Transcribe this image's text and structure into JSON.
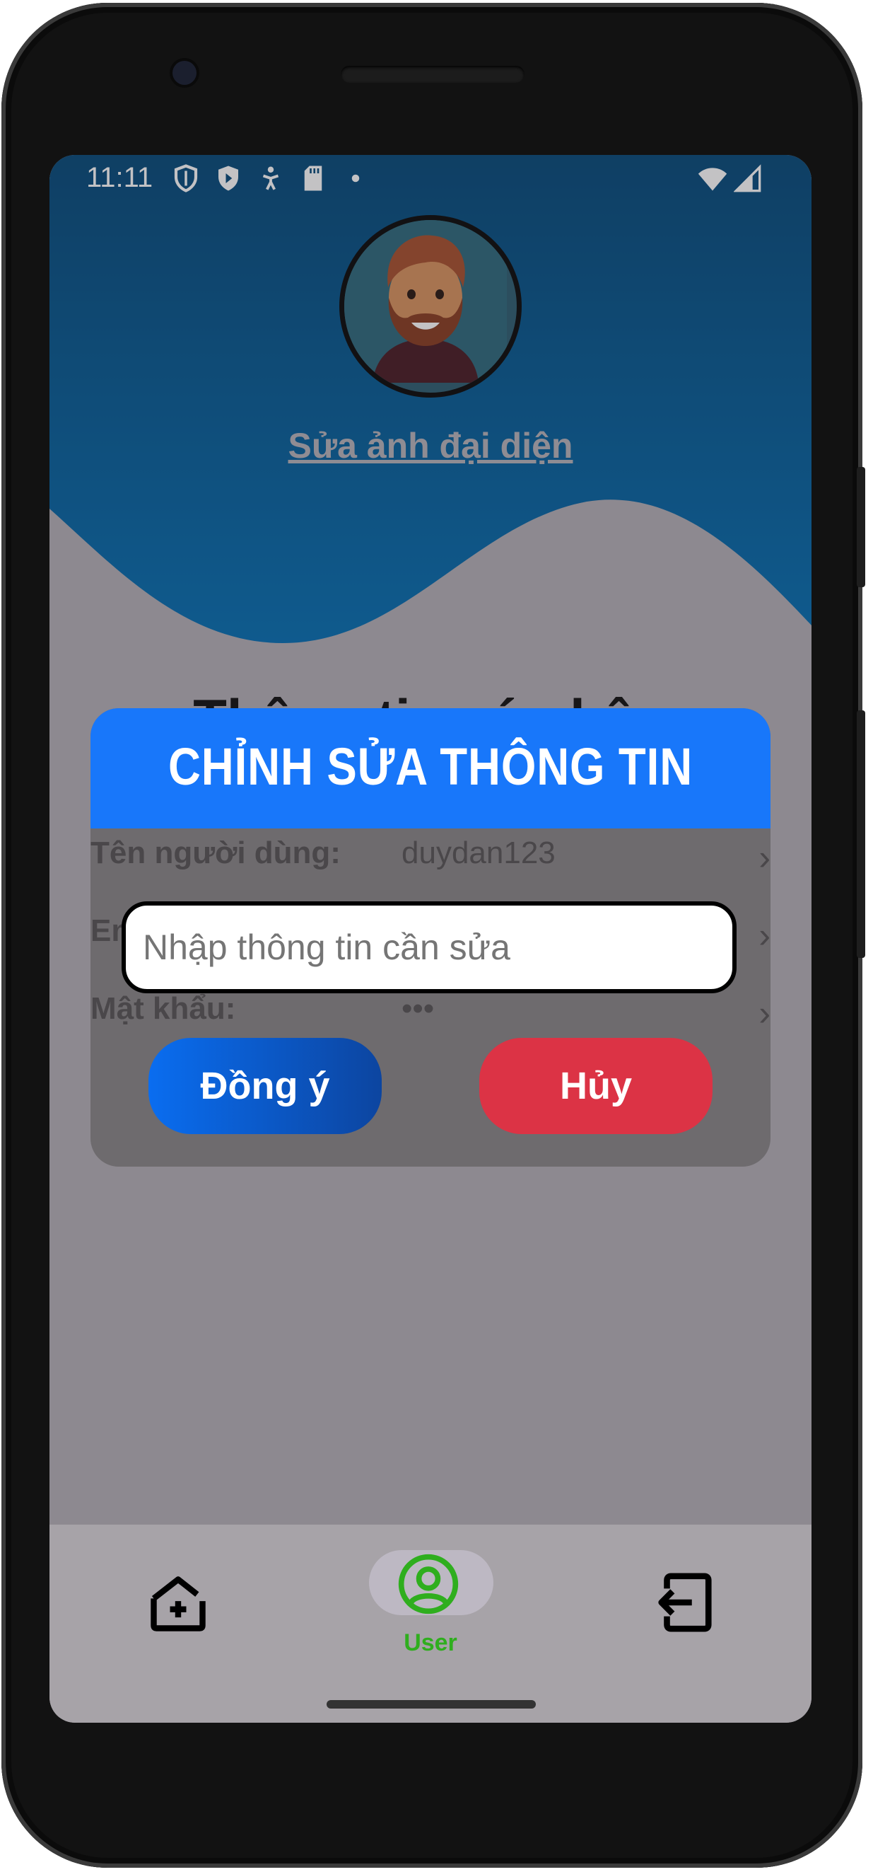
{
  "status_bar": {
    "time": "11:11",
    "left_icons": [
      "shield-icon",
      "play-protect-icon",
      "accessibility-icon",
      "sd-card-icon",
      "dot-icon"
    ],
    "right_icons": [
      "wifi-icon",
      "signal-icon"
    ]
  },
  "profile": {
    "edit_avatar_link": "Sửa ảnh đại diện",
    "section_title": "Thông tin cá nhân"
  },
  "info_rows": [
    {
      "label": "Tên người dùng:",
      "value": "duydan123"
    },
    {
      "label": "Email:",
      "value": ""
    },
    {
      "label": "Mật khẩu:",
      "value": "•••"
    }
  ],
  "dialog": {
    "title": "CHỈNH SỬA THÔNG TIN",
    "input_placeholder": "Nhập thông tin cần sửa",
    "input_value": "",
    "confirm_label": "Đồng ý",
    "cancel_label": "Hủy"
  },
  "bottom_nav": {
    "items": [
      {
        "icon": "home-add-icon",
        "label": ""
      },
      {
        "icon": "user-icon",
        "label": "User"
      },
      {
        "icon": "logout-icon",
        "label": ""
      }
    ],
    "active_index": 1
  },
  "colors": {
    "header_top": "#064a7a",
    "header_bottom": "#0670b4",
    "dialog_header": "#1877fa",
    "confirm_button": "#0a6df0",
    "cancel_button": "#dc3345",
    "active_nav": "#2fae1e"
  }
}
